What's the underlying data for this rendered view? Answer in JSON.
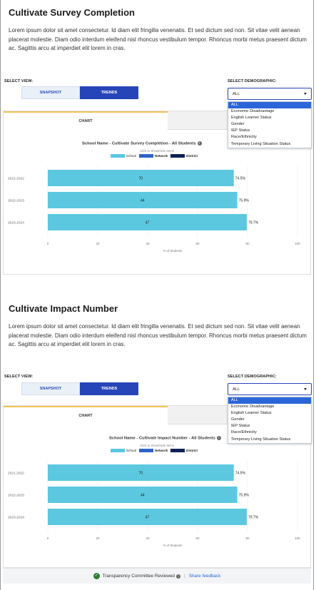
{
  "sections": [
    {
      "title": "Cultivate Survey Completion",
      "body": "Lorem ipsum dolor sit amet consectetur. Id diam elit fringilla venenatis. Et sed dictum sed non. Sit vitae velit aenean placerat molestie. Diam odio interdum eleifend nisl rhoncus vestibulum tempor. Rhoncus morbi metus praesent dictum ac. Sagittis arcu at imperdiet elit lorem in cras.",
      "select_view_label": "SELECT VIEW:",
      "view_options": [
        "SNAPSHOT",
        "TRENDS"
      ],
      "select_demographic_label": "SELECT DEMOGRAPHIC:",
      "selected_demographic": "ALL",
      "demographic_options": [
        "ALL",
        "Economic Disadvantage",
        "English Learner Status",
        "Gender",
        "IEP Status",
        "Race/Ethnicity",
        "Temporary Living Situation Status"
      ],
      "tabs": [
        "CHART",
        "VI"
      ],
      "chart_hint": "Click to Show/Hide Items",
      "chart_title": "School Name - Cultivate Survey Completion - All Students"
    },
    {
      "title": "Cultivate Impact Number",
      "body": "Lorem ipsum dolor sit amet consectetur. Id diam elit fringilla venenatis. Et sed dictum sed non. Sit vitae velit aenean placerat molestie. Diam odio interdum eleifend nisl rhoncus vestibulum tempor. Rhoncus morbi metus praesent dictum ac. Sagittis arcu at imperdiet elit lorem in cras.",
      "select_view_label": "SELECT VIEW:",
      "view_options": [
        "SNAPSHOT",
        "TRENDS"
      ],
      "select_demographic_label": "SELECT DEMOGRAPHIC:",
      "selected_demographic": "ALL",
      "demographic_options": [
        "ALL",
        "Economic Disadvantage",
        "English Learner Status",
        "Gender",
        "IEP Status",
        "Race/Ethnicity",
        "Temporary Living Situation Status"
      ],
      "tabs": [
        "CHART",
        "VI"
      ],
      "chart_hint": "Click to Show/Hide Items",
      "chart_title": "School Name - Cultivate Impact Number - All Students"
    }
  ],
  "chart_data": [
    {
      "type": "bar",
      "orientation": "horizontal",
      "title": "School Name - Cultivate Survey Completion - All Students",
      "categories": [
        "2021-2022",
        "2022-2023",
        "2023-2024"
      ],
      "series": [
        {
          "name": "School",
          "values": [
            70,
            44,
            47
          ],
          "color": "#5bc8df"
        },
        {
          "name": "Network",
          "values": [
            74.5,
            75.9,
            79.7
          ],
          "color": "#2f63c8"
        },
        {
          "name": "District",
          "values": [],
          "color": "#0f2257"
        }
      ],
      "bar_values": [
        74.5,
        75.9,
        79.7
      ],
      "inner_labels": [
        "70",
        "44",
        "47"
      ],
      "end_labels": [
        "74.5%",
        "75.9%",
        "79.7%"
      ],
      "xticks": [
        "0",
        "20",
        "40",
        "60",
        "80",
        "100"
      ],
      "xlim": [
        0,
        100
      ],
      "xlabel": "% of Students",
      "legend_position": "top-center"
    },
    {
      "type": "bar",
      "orientation": "horizontal",
      "title": "School Name - Cultivate Impact Number - All Students",
      "categories": [
        "2021-2022",
        "2022-2023",
        "2023-2024"
      ],
      "series": [
        {
          "name": "School",
          "values": [
            70,
            44,
            47
          ],
          "color": "#5bc8df"
        },
        {
          "name": "Network",
          "values": [
            74.5,
            75.9,
            79.7
          ],
          "color": "#2f63c8"
        },
        {
          "name": "District",
          "values": [],
          "color": "#0f2257"
        }
      ],
      "bar_values": [
        74.5,
        75.9,
        79.7
      ],
      "inner_labels": [
        "70",
        "44",
        "47"
      ],
      "end_labels": [
        "74.5%",
        "75.9%",
        "79.7%"
      ],
      "xticks": [
        "0",
        "20",
        "40",
        "60",
        "80",
        "100"
      ],
      "xlim": [
        0,
        100
      ],
      "xlabel": "% of Students",
      "legend_position": "top-center"
    }
  ],
  "footer": {
    "status_text": "Transparency Committee Reviewed",
    "separator": "|",
    "link_text": "Share feedback",
    "status_color": "#2e7d32"
  }
}
